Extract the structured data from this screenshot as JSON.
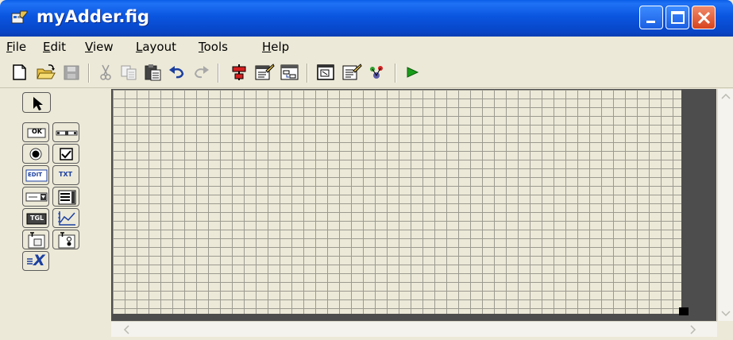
{
  "window": {
    "title": "myAdder.fig"
  },
  "menu": {
    "items": [
      {
        "label": "File",
        "accel": "F"
      },
      {
        "label": "Edit",
        "accel": "E"
      },
      {
        "label": "View",
        "accel": "V"
      },
      {
        "label": "Layout",
        "accel": "L"
      },
      {
        "label": "Tools",
        "accel": "T"
      },
      {
        "label": "Help",
        "accel": "H"
      }
    ]
  },
  "toolbar": {
    "icons": [
      "new-icon",
      "open-icon",
      "save-icon",
      "cut-icon",
      "copy-icon",
      "paste-icon",
      "undo-icon",
      "redo-icon",
      "align-icon",
      "menu-editor-icon",
      "tab-order-icon",
      "mfile-editor-icon",
      "property-inspector-icon",
      "object-browser-icon",
      "run-icon"
    ]
  },
  "palette": {
    "labels": {
      "push_button": "OK",
      "edit_text": "EDIT",
      "static_text": "TXT",
      "toggle_button": "TGL",
      "axes_label": "X"
    }
  },
  "colors": {
    "titlebar": "#0a55df",
    "chrome": "#ece9d8",
    "grid_line": "#9c9a90",
    "canvas_border": "#4d4d4d",
    "run_arrow": "#1a9c1a"
  }
}
